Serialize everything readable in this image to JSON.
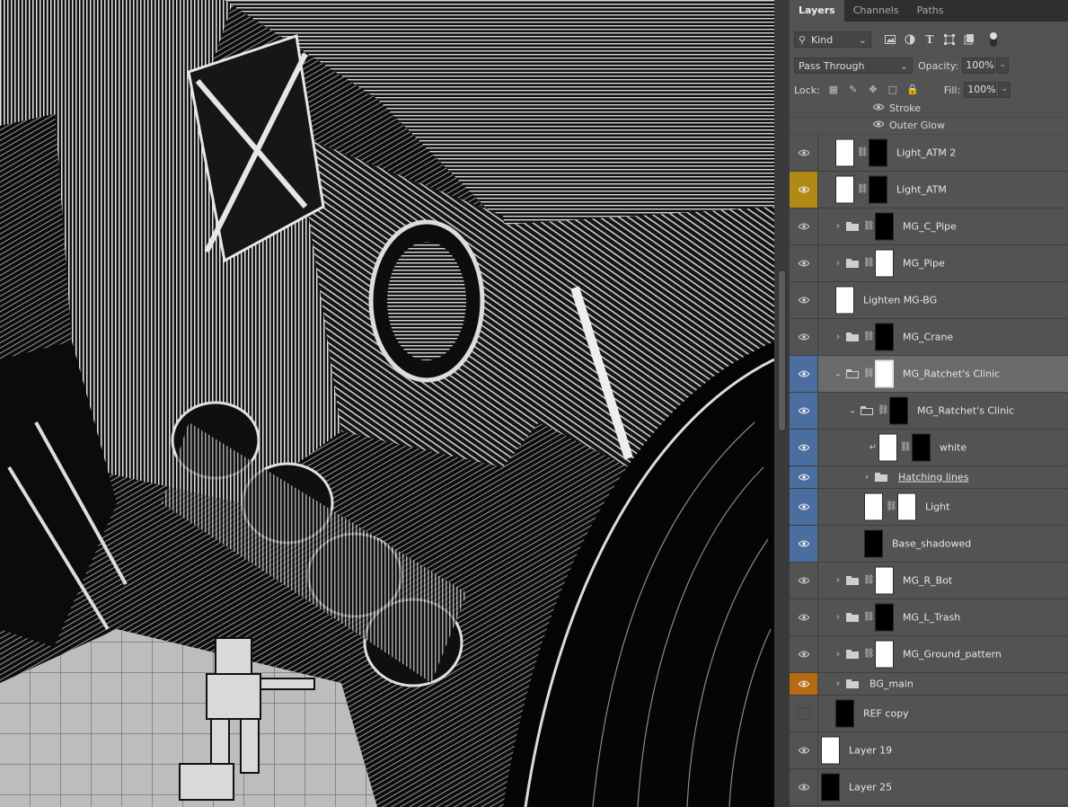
{
  "panel": {
    "tabs": [
      {
        "label": "Layers",
        "active": true
      },
      {
        "label": "Channels",
        "active": false
      },
      {
        "label": "Paths",
        "active": false
      }
    ],
    "filter": {
      "kind_label": "Kind",
      "icons": [
        "image-filter-icon",
        "adjustment-filter-icon",
        "type-filter-icon",
        "shape-filter-icon",
        "smart-object-filter-icon"
      ]
    },
    "blend_mode": "Pass Through",
    "opacity_label": "Opacity:",
    "opacity_value": "100%",
    "lock_label": "Lock:",
    "fill_label": "Fill:",
    "fill_value": "100%"
  },
  "effects": [
    {
      "name": "Stroke"
    },
    {
      "name": "Outer Glow"
    }
  ],
  "layers": [
    {
      "name": "Light_ATM 2",
      "visible": true,
      "tag": "none",
      "type": "masked"
    },
    {
      "name": "Light_ATM",
      "visible": true,
      "tag": "yellow",
      "type": "masked"
    },
    {
      "name": "MG_C_Pipe",
      "visible": true,
      "tag": "none",
      "type": "group-masked"
    },
    {
      "name": "MG_Pipe",
      "visible": true,
      "tag": "none",
      "type": "group-masked"
    },
    {
      "name": "Lighten MG-BG",
      "visible": true,
      "tag": "none",
      "type": "plain"
    },
    {
      "name": "MG_Crane",
      "visible": true,
      "tag": "none",
      "type": "group-masked"
    },
    {
      "name": "MG_Ratchet's Clinic",
      "visible": true,
      "tag": "blue",
      "type": "group-open-selected"
    },
    {
      "name": "MG_Ratchet's Clinic",
      "visible": true,
      "tag": "blue",
      "type": "group-open-nested"
    },
    {
      "name": "white",
      "visible": true,
      "tag": "blue",
      "type": "clipped-masked"
    },
    {
      "name": "Hatching lines",
      "visible": true,
      "tag": "blue",
      "type": "group-collapsed"
    },
    {
      "name": "Light",
      "visible": true,
      "tag": "blue",
      "type": "masked-nested"
    },
    {
      "name": "Base_shadowed",
      "visible": true,
      "tag": "blue",
      "type": "plain-nested"
    },
    {
      "name": "MG_R_Bot",
      "visible": true,
      "tag": "none",
      "type": "group-masked"
    },
    {
      "name": "MG_L_Trash",
      "visible": true,
      "tag": "none",
      "type": "group-masked"
    },
    {
      "name": "MG_Ground_pattern",
      "visible": true,
      "tag": "none",
      "type": "group-masked"
    },
    {
      "name": "BG_main",
      "visible": true,
      "tag": "orange",
      "type": "group"
    },
    {
      "name": "REF copy",
      "visible": false,
      "tag": "none",
      "type": "plain"
    },
    {
      "name": "Layer 19",
      "visible": true,
      "tag": "none",
      "type": "plain"
    },
    {
      "name": "Layer 25",
      "visible": true,
      "tag": "none",
      "type": "plain"
    }
  ],
  "colors": {
    "tag_blue": "#4b6ea0",
    "tag_yellow": "#b08a14",
    "tag_orange": "#b86a12",
    "panel_bg": "#535353"
  }
}
